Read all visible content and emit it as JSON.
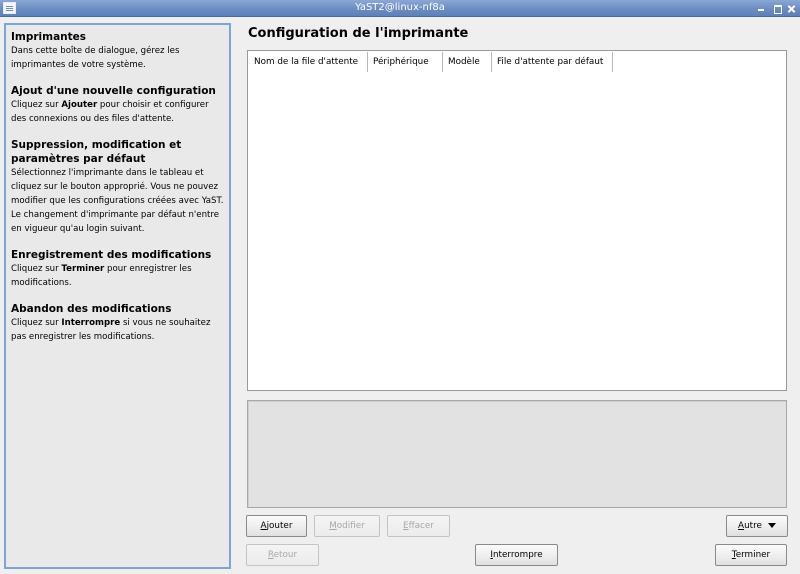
{
  "window": {
    "title": "YaST2@linux-nf8a"
  },
  "help": {
    "sections": [
      {
        "heading": "Imprimantes",
        "text": "Dans cette boîte de dialogue, gérez les imprimantes de votre système."
      },
      {
        "heading": "Ajout d'une nouvelle configuration",
        "text_before": "Cliquez sur ",
        "bold": "Ajouter",
        "text_after": " pour choisir et configurer des connexions ou des files d'attente."
      },
      {
        "heading": "Suppression, modification et paramètres par défaut",
        "text": "Sélectionnez l'imprimante dans le tableau et cliquez sur le bouton approprié. Vous ne pouvez modifier que les configurations créées avec YaST. Le changement d'imprimante par défaut n'entre en vigueur qu'au login suivant."
      },
      {
        "heading": "Enregistrement des modifications",
        "text_before": "Cliquez sur ",
        "bold": "Terminer",
        "text_after": " pour enregistrer les modifications."
      },
      {
        "heading": "Abandon des modifications",
        "text_before": "Cliquez sur ",
        "bold": "Interrompre",
        "text_after": " si vous ne souhaitez pas enregistrer les modifications."
      }
    ]
  },
  "main": {
    "title": "Configuration de l'imprimante",
    "table": {
      "columns": [
        "Nom de la file d'attente",
        "Périphérique",
        "Modèle",
        "File d'attente par défaut"
      ],
      "rows": []
    }
  },
  "buttons": {
    "add": {
      "before": "",
      "underline": "A",
      "after": "jouter"
    },
    "modify": {
      "before": "",
      "underline": "M",
      "after": "odifier"
    },
    "delete": {
      "before": "",
      "underline": "E",
      "after": "ffacer"
    },
    "other": {
      "before": "",
      "underline": "A",
      "after": "utre"
    },
    "back": {
      "before": "",
      "underline": "R",
      "after": "etour"
    },
    "abort": {
      "before": "",
      "underline": "I",
      "after": "nterrompre"
    },
    "finish": {
      "before": "",
      "underline": "T",
      "after": "erminer"
    }
  }
}
